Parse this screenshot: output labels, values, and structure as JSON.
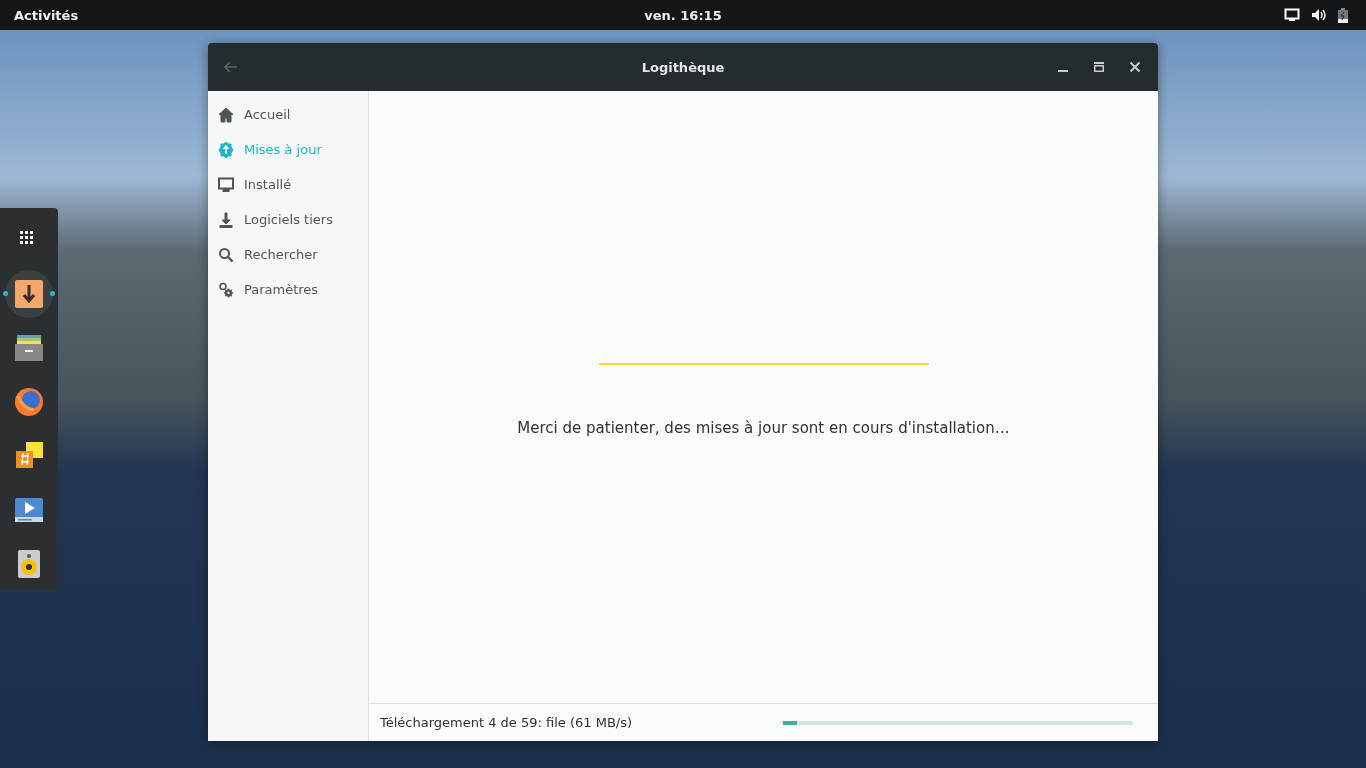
{
  "top_bar": {
    "activities": "Activités",
    "clock": "ven. 16:15"
  },
  "dock": {
    "items": [
      {
        "kind": "apps",
        "running": false
      },
      {
        "kind": "installer",
        "running": true
      },
      {
        "kind": "files",
        "running": false
      },
      {
        "kind": "browser",
        "running": false
      },
      {
        "kind": "notes",
        "running": false
      },
      {
        "kind": "video",
        "running": false
      },
      {
        "kind": "speaker",
        "running": false
      }
    ]
  },
  "window": {
    "title": "Logithèque",
    "sidebar": {
      "items": [
        {
          "kind": "home",
          "label": "Accueil",
          "selected": false
        },
        {
          "kind": "update",
          "label": "Mises à jour",
          "selected": true
        },
        {
          "kind": "monitor",
          "label": "Installé",
          "selected": false
        },
        {
          "kind": "download",
          "label": "Logiciels tiers",
          "selected": false
        },
        {
          "kind": "search",
          "label": "Rechercher",
          "selected": false
        },
        {
          "kind": "gears",
          "label": "Paramètres",
          "selected": false
        }
      ]
    },
    "message": "Merci de patienter, des mises à jour sont en cours d'installation…",
    "status_bar": {
      "text": "Téléchargement 4 de 59: file (61 MB/s)",
      "level": 0.04
    }
  }
}
